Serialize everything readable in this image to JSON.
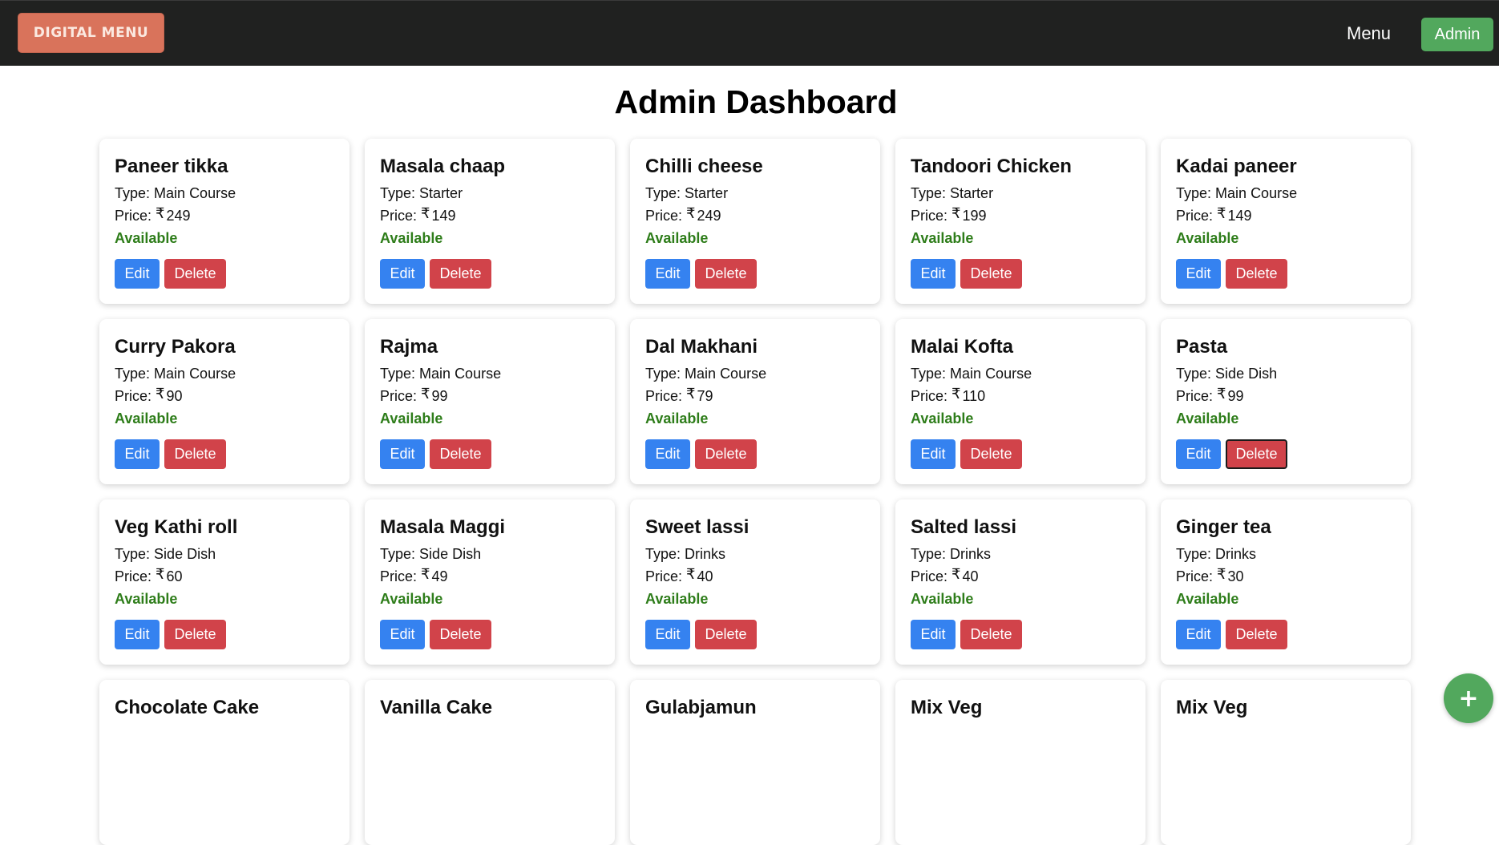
{
  "navbar": {
    "logo_text": "Digital Menu",
    "menu_link": "Menu",
    "admin_button": "Admin"
  },
  "page": {
    "title": "Admin Dashboard"
  },
  "labels": {
    "type_prefix": "Type:",
    "price_prefix": "Price:",
    "currency_symbol": "₹",
    "edit": "Edit",
    "delete": "Delete"
  },
  "items": [
    {
      "name": "Paneer tikka",
      "type": "Main Course",
      "price": "249",
      "status": "Available"
    },
    {
      "name": "Masala chaap",
      "type": "Starter",
      "price": "149",
      "status": "Available"
    },
    {
      "name": "Chilli cheese",
      "type": "Starter",
      "price": "249",
      "status": "Available"
    },
    {
      "name": "Tandoori Chicken",
      "type": "Starter",
      "price": "199",
      "status": "Available"
    },
    {
      "name": "Kadai paneer",
      "type": "Main Course",
      "price": "149",
      "status": "Available"
    },
    {
      "name": "Curry Pakora",
      "type": "Main Course",
      "price": "90",
      "status": "Available"
    },
    {
      "name": "Rajma",
      "type": "Main Course",
      "price": "99",
      "status": "Available"
    },
    {
      "name": "Dal Makhani",
      "type": "Main Course",
      "price": "79",
      "status": "Available"
    },
    {
      "name": "Malai Kofta",
      "type": "Main Course",
      "price": "110",
      "status": "Available"
    },
    {
      "name": "Pasta",
      "type": "Side Dish",
      "price": "99",
      "status": "Available"
    },
    {
      "name": "Veg Kathi roll",
      "type": "Side Dish",
      "price": "60",
      "status": "Available"
    },
    {
      "name": "Masala Maggi",
      "type": "Side Dish",
      "price": "49",
      "status": "Available"
    },
    {
      "name": "Sweet lassi",
      "type": "Drinks",
      "price": "40",
      "status": "Available"
    },
    {
      "name": "Salted lassi",
      "type": "Drinks",
      "price": "40",
      "status": "Available"
    },
    {
      "name": "Ginger tea",
      "type": "Drinks",
      "price": "30",
      "status": "Available"
    },
    {
      "name": "Chocolate Cake"
    },
    {
      "name": "Vanilla Cake"
    },
    {
      "name": "Gulabjamun"
    },
    {
      "name": "Mix Veg"
    },
    {
      "name": "Mix Veg"
    }
  ],
  "fab": {
    "icon": "plus-icon",
    "label": "+"
  },
  "colors": {
    "navbar_bg": "#202120",
    "logo_bg": "#d9735b",
    "admin_green": "#52a85d",
    "edit_blue": "#3582f0",
    "delete_red": "#d1434a",
    "available_green": "#2e7d1a"
  }
}
